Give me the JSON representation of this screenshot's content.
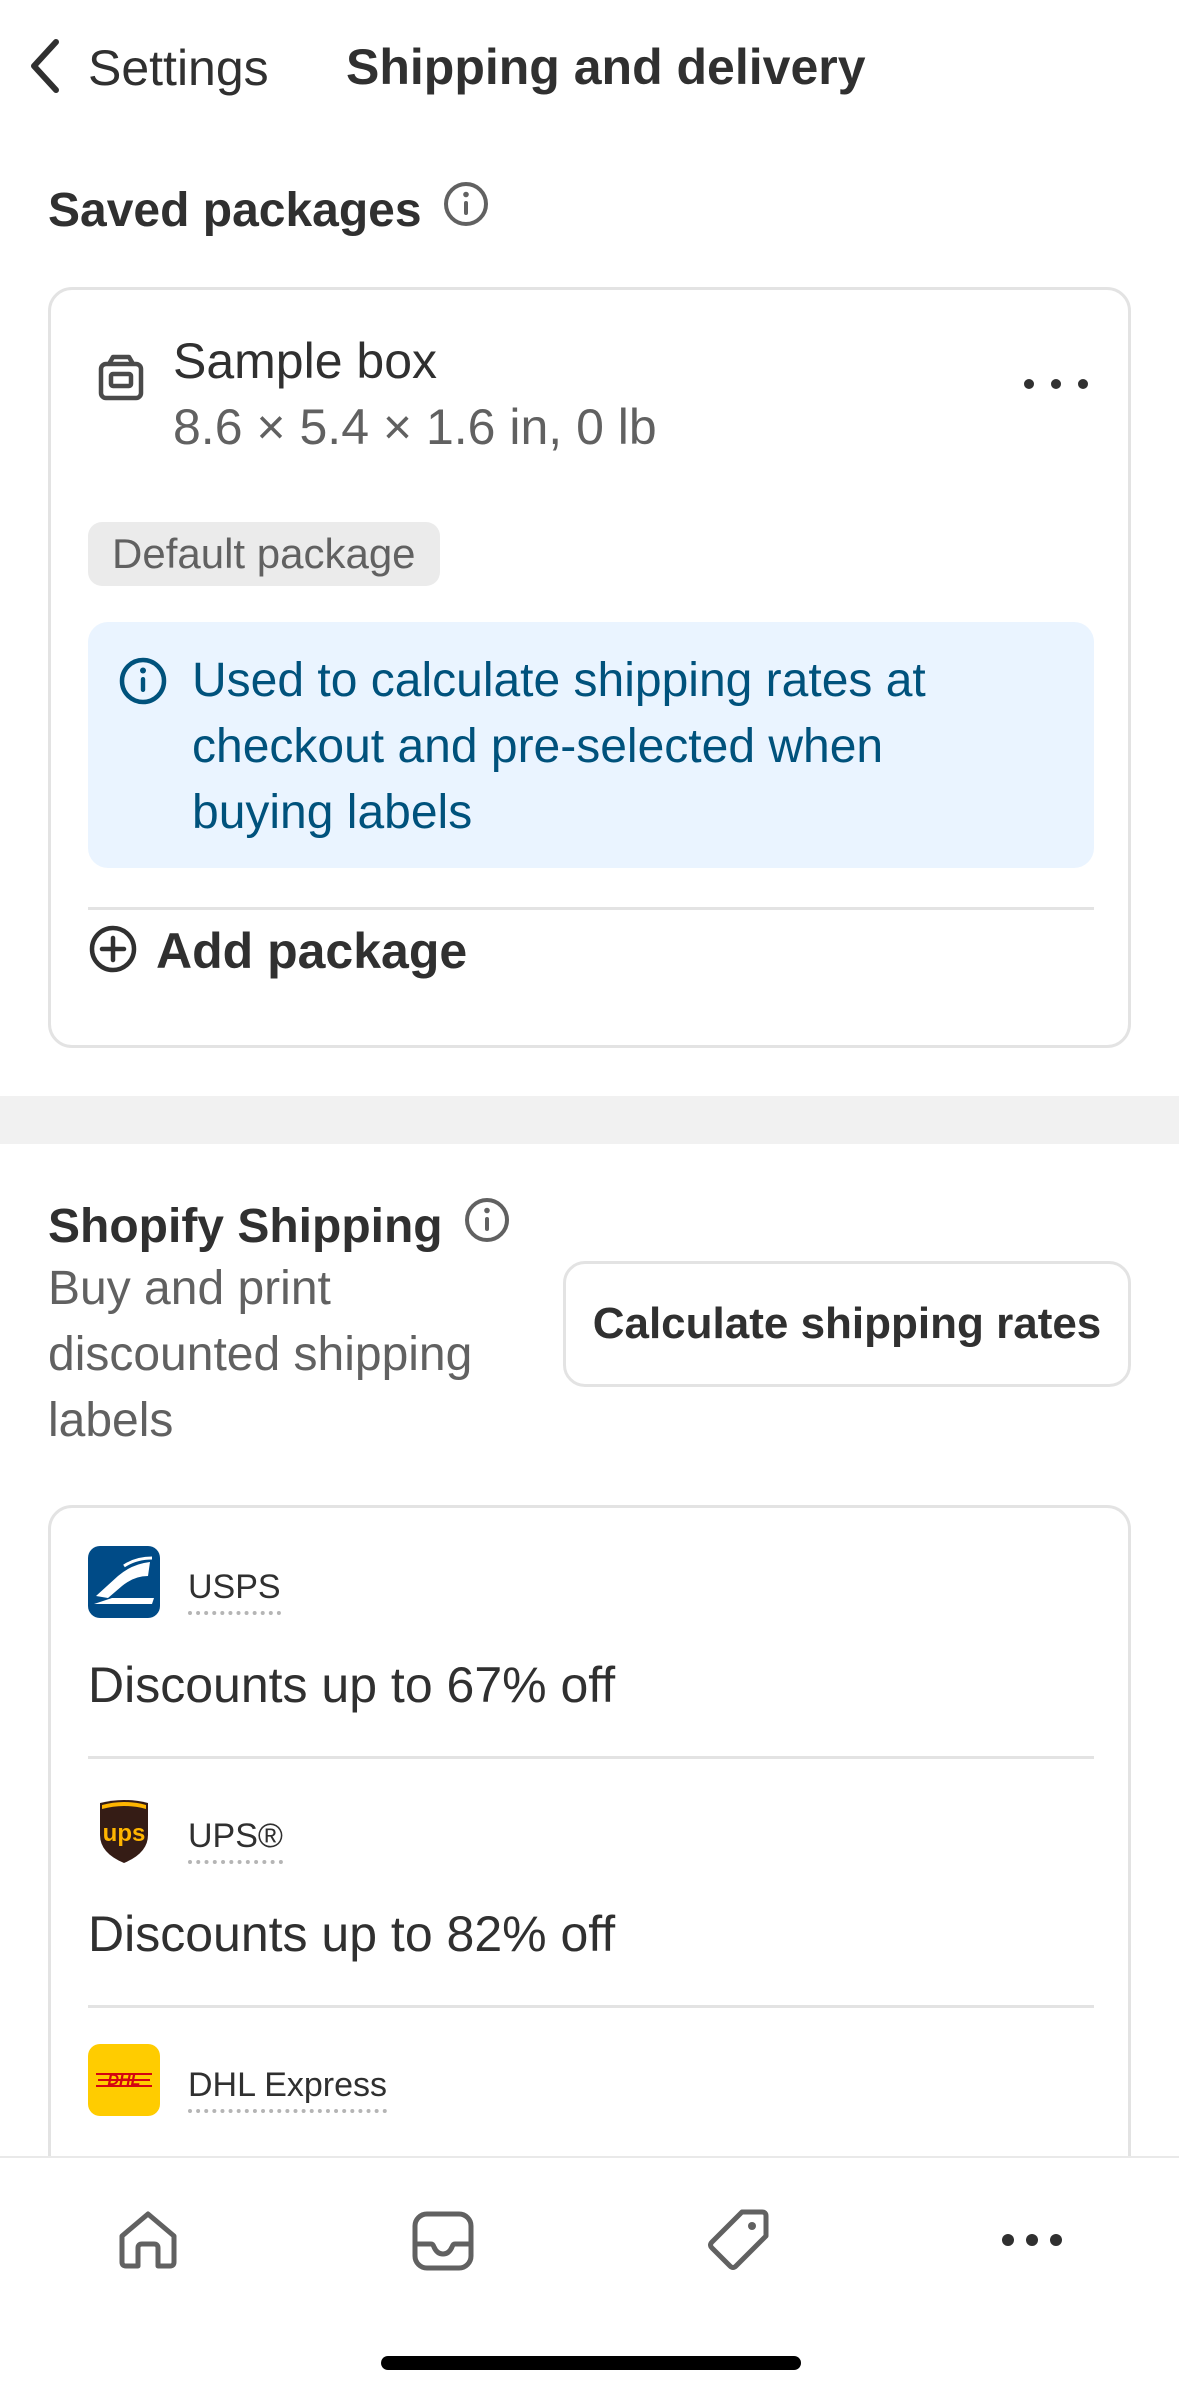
{
  "header": {
    "back_label": "Settings",
    "title": "Shipping and delivery"
  },
  "saved_packages": {
    "heading": "Saved packages",
    "package": {
      "name": "Sample box",
      "dimensions": "8.6 × 5.4 × 1.6 in, 0 lb",
      "badge": "Default package"
    },
    "info_text": "Used to calculate shipping rates at checkout and pre-selected when buying labels",
    "add_label": "Add package"
  },
  "shopify_shipping": {
    "heading": "Shopify Shipping",
    "description": "Buy and print discounted shipping labels",
    "calc_button": "Calculate shipping rates",
    "carriers": [
      {
        "name": "USPS",
        "discount": "Discounts up to 67% off",
        "logo": "usps-eagle-logo"
      },
      {
        "name": "UPS®",
        "discount": "Discounts up to 82% off",
        "logo": "ups-shield-logo"
      },
      {
        "name": "DHL Express",
        "discount": "",
        "logo": "dhl-logo"
      }
    ]
  },
  "bottom_nav": {
    "items": [
      "home-icon",
      "inbox-icon",
      "tag-icon",
      "more-icon"
    ]
  },
  "colors": {
    "text": "#303030",
    "subdued": "#616161",
    "info_bg": "#eaf4ff",
    "info_text": "#00527c",
    "usps_blue": "#004b87",
    "ups_brown": "#351c15",
    "ups_gold": "#ffb500",
    "dhl_yellow": "#ffcc00",
    "dhl_red": "#d40511"
  }
}
